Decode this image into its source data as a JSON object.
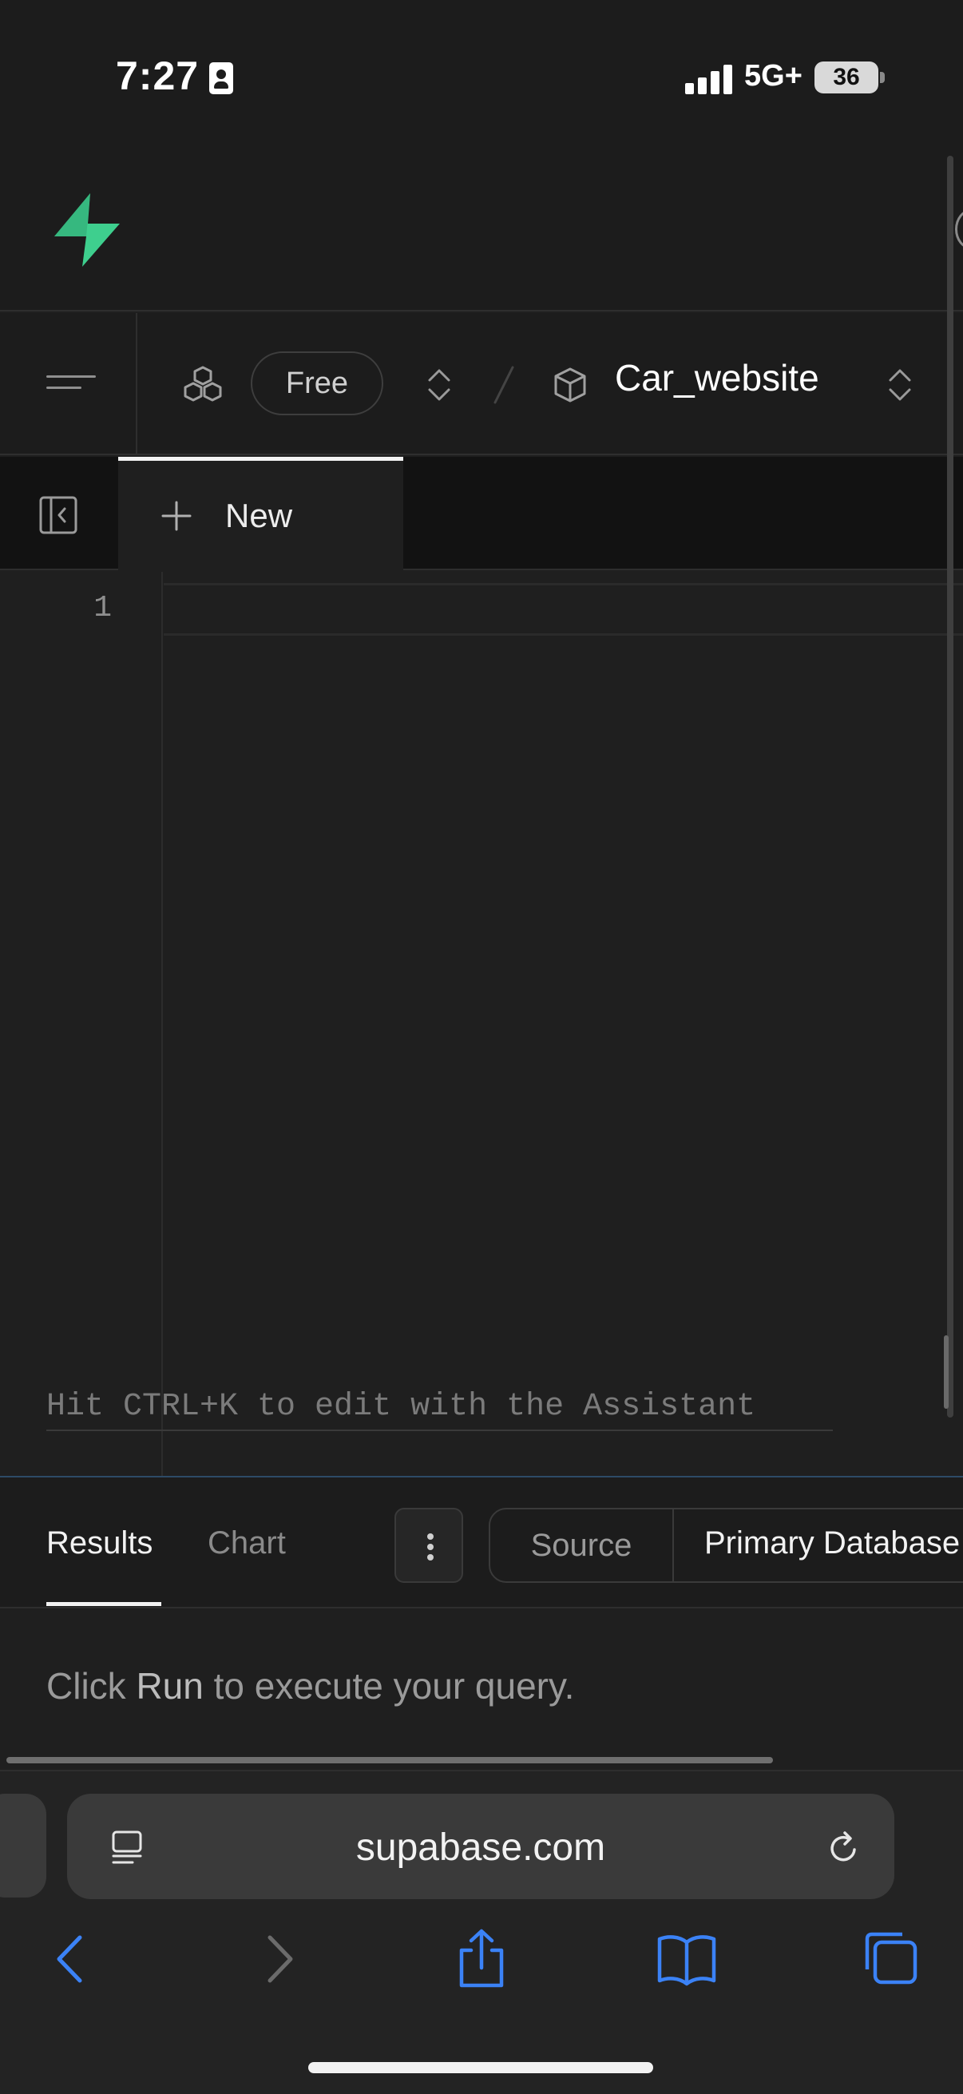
{
  "status_bar": {
    "time": "7:27",
    "network": "5G+",
    "battery": "36"
  },
  "project_bar": {
    "plan": "Free",
    "project_name": "Car_website"
  },
  "tabs": {
    "new_label": "New"
  },
  "editor": {
    "line_number": "1",
    "assistant_hint": "Hit CTRL+K to edit with the Assistant"
  },
  "results": {
    "tab_results": "Results",
    "tab_chart": "Chart",
    "source_label": "Source",
    "database_label": "Primary Database",
    "run_hint_prefix": "Click ",
    "run_hint_run": "Run",
    "run_hint_suffix": " to execute your query."
  },
  "browser": {
    "url": "supabase.com"
  },
  "colors": {
    "brand_green": "#3ecf8e",
    "safari_blue": "#3b82f6",
    "background": "#1f1f1f"
  },
  "icons": [
    "id-card-icon",
    "signal-icon",
    "battery-icon",
    "supabase-logo-icon",
    "menu-icon",
    "organization-icon",
    "chevron-updown-icon",
    "project-box-icon",
    "sidebar-toggle-icon",
    "plus-icon",
    "more-vertical-icon",
    "reader-mode-icon",
    "reload-icon",
    "back-icon",
    "forward-icon",
    "share-icon",
    "bookmarks-icon",
    "tabs-icon"
  ]
}
